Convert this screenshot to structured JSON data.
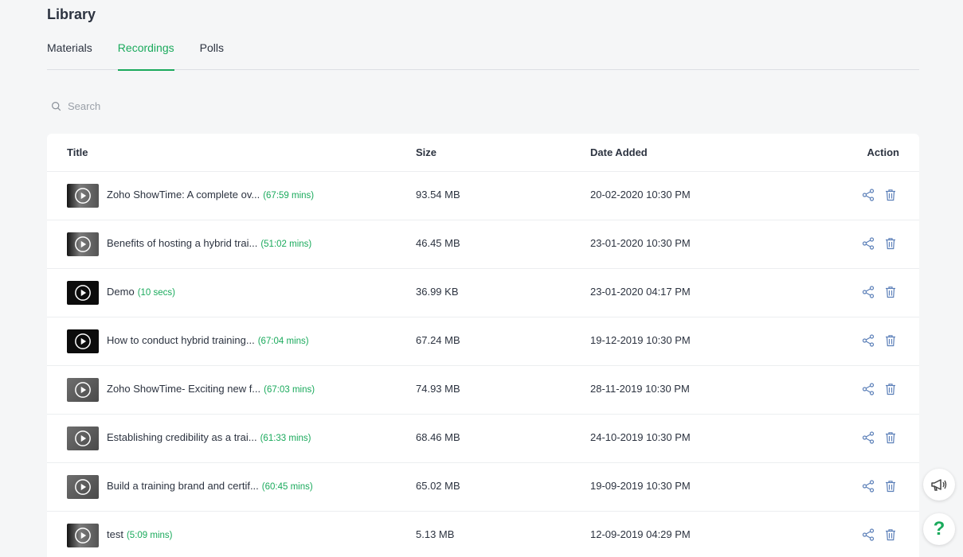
{
  "page": {
    "title": "Library"
  },
  "tabs": [
    {
      "label": "Materials",
      "active": false
    },
    {
      "label": "Recordings",
      "active": true
    },
    {
      "label": "Polls",
      "active": false
    }
  ],
  "search": {
    "placeholder": "Search",
    "value": ""
  },
  "table": {
    "headers": {
      "title": "Title",
      "size": "Size",
      "date": "Date Added",
      "action": "Action"
    },
    "rows": [
      {
        "title": "Zoho ShowTime: A complete ov...",
        "duration": "(67:59 mins)",
        "size": "93.54 MB",
        "date": "20-02-2020 10:30 PM",
        "thumb": "mixed"
      },
      {
        "title": "Benefits of hosting a hybrid trai...",
        "duration": "(51:02 mins)",
        "size": "46.45 MB",
        "date": "23-01-2020 10:30 PM",
        "thumb": "mixed"
      },
      {
        "title": "Demo",
        "duration": "(10 secs)",
        "size": "36.99 KB",
        "date": "23-01-2020 04:17 PM",
        "thumb": "dark"
      },
      {
        "title": "How to conduct hybrid training...",
        "duration": "(67:04 mins)",
        "size": "67.24 MB",
        "date": "19-12-2019 10:30 PM",
        "thumb": "dark"
      },
      {
        "title": "Zoho ShowTime- Exciting new f...",
        "duration": "(67:03 mins)",
        "size": "74.93 MB",
        "date": "28-11-2019 10:30 PM",
        "thumb": "grey"
      },
      {
        "title": "Establishing credibility as a trai...",
        "duration": "(61:33 mins)",
        "size": "68.46 MB",
        "date": "24-10-2019 10:30 PM",
        "thumb": "grey"
      },
      {
        "title": "Build a training brand and certif...",
        "duration": "(60:45 mins)",
        "size": "65.02 MB",
        "date": "19-09-2019 10:30 PM",
        "thumb": "grey"
      },
      {
        "title": "test",
        "duration": "(5:09 mins)",
        "size": "5.13 MB",
        "date": "12-09-2019 04:29 PM",
        "thumb": "mixed"
      }
    ]
  },
  "floating": {
    "help_label": "?"
  },
  "icons": {
    "search": "search-icon",
    "share": "share-icon",
    "delete": "trash-icon",
    "play": "play-icon",
    "announce": "megaphone-icon",
    "help": "help-icon"
  },
  "colors": {
    "accent": "#1aaa5c",
    "icon": "#5b7fb8"
  }
}
